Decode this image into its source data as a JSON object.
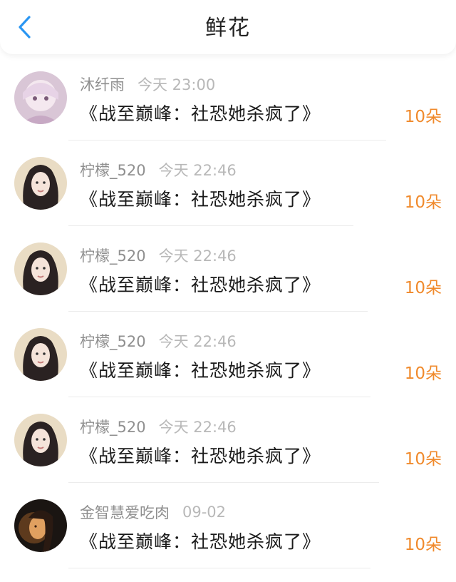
{
  "header": {
    "title": "鲜花",
    "back_icon": "chevron-left-icon",
    "accent_color": "#2a96f2"
  },
  "flowers": [
    {
      "user": "沐纤雨",
      "time": "今天 23:00",
      "book": "《战至巅峰：社恐她杀疯了》",
      "count": "10朵",
      "avatar": "cartoon-girl-avatar"
    },
    {
      "user": "柠檬_520",
      "time": "今天 22:46",
      "book": "《战至巅峰：社恐她杀疯了》",
      "count": "10朵",
      "avatar": "woman-photo-avatar"
    },
    {
      "user": "柠檬_520",
      "time": "今天 22:46",
      "book": "《战至巅峰：社恐她杀疯了》",
      "count": "10朵",
      "avatar": "woman-photo-avatar"
    },
    {
      "user": "柠檬_520",
      "time": "今天 22:46",
      "book": "《战至巅峰：社恐她杀疯了》",
      "count": "10朵",
      "avatar": "woman-photo-avatar"
    },
    {
      "user": "柠檬_520",
      "time": "今天 22:46",
      "book": "《战至巅峰：社恐她杀疯了》",
      "count": "10朵",
      "avatar": "woman-photo-avatar"
    },
    {
      "user": "金智慧爱吃肉",
      "time": "09-02",
      "book": "《战至巅峰：社恐她杀疯了》",
      "count": "10朵",
      "avatar": "dark-portrait-avatar"
    }
  ],
  "colors": {
    "username": "#8f8f8f",
    "time": "#b8b8b8",
    "book_title": "#1a1a1a",
    "flower_count": "#f08a2c"
  }
}
